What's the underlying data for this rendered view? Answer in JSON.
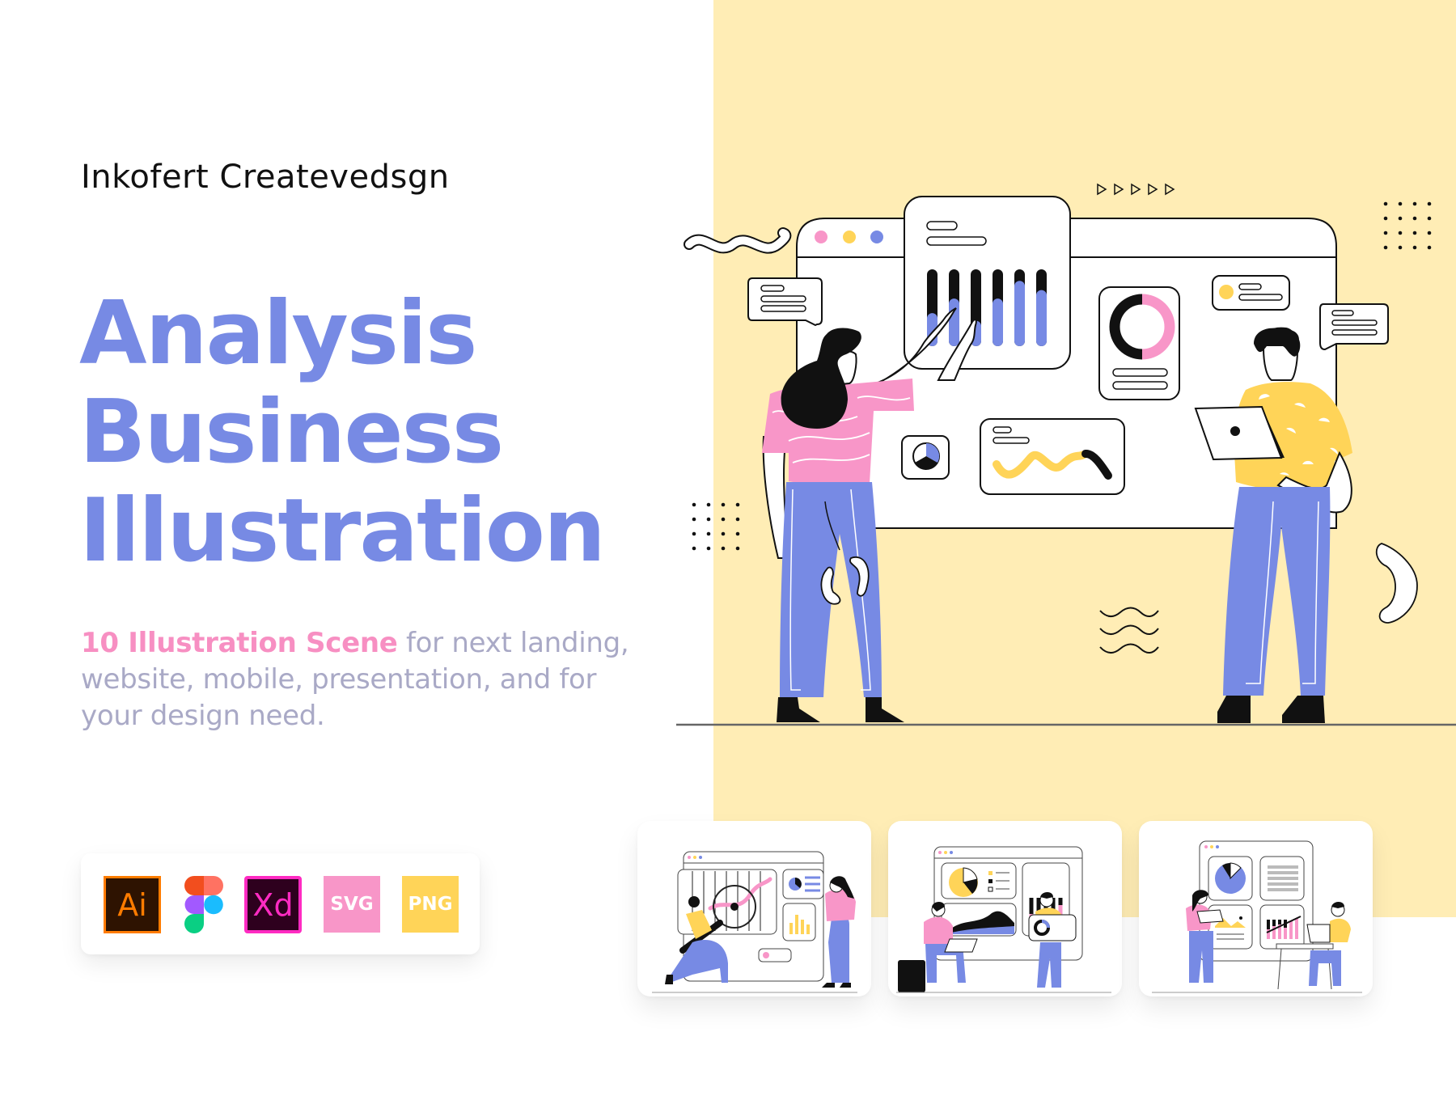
{
  "brand": "Inkofert Createvedsgn",
  "title": {
    "lines": [
      "Analysis",
      "Business",
      "Illustration"
    ]
  },
  "description": {
    "highlight": "10 Illustration Scene",
    "text": " for next landing, website, mobile, presentation, and for your design need."
  },
  "tools": [
    {
      "name": "adobe-illustrator",
      "label": "Ai"
    },
    {
      "name": "figma",
      "label": ""
    },
    {
      "name": "adobe-xd",
      "label": "Xd"
    },
    {
      "name": "svg-format",
      "label": "SVG"
    },
    {
      "name": "png-format",
      "label": "PNG"
    }
  ],
  "colors": {
    "title": "#778AE4",
    "highlight": "#F78FC2",
    "body_text": "#A9A9C6",
    "panel_yellow": "#FFEDB5",
    "accent_pink": "#F896C8",
    "accent_yellow": "#FFD458",
    "accent_blue": "#778AE4"
  },
  "hero_bar_chart": {
    "bars": [
      0.43,
      0.62,
      0.33,
      0.62,
      0.85,
      0.73
    ]
  },
  "preview_cards": [
    {
      "scene": "magnifier-analysis"
    },
    {
      "scene": "pie-chart-laptop"
    },
    {
      "scene": "dashboard-desk"
    }
  ]
}
